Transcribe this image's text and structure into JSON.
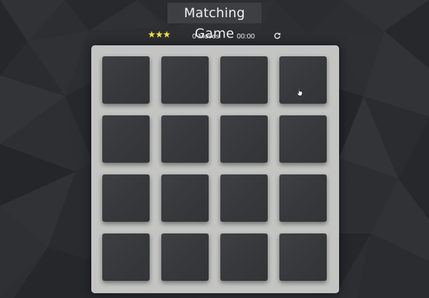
{
  "header": {
    "title": "Matching Game"
  },
  "score_panel": {
    "stars_total": 3,
    "stars_filled": 3,
    "star_color": "#f5e032",
    "moves_text": "0 Moves",
    "timer_text": "00:00",
    "restart_icon": "restart-icon"
  },
  "deck": {
    "rows": 4,
    "columns": 4,
    "card_state": "face-down",
    "card_count": 16
  },
  "colors": {
    "background": "#2b2d31",
    "deck": "#c4c5c3",
    "card": "#3a3b3e",
    "title_bg": "#3d3f43"
  }
}
